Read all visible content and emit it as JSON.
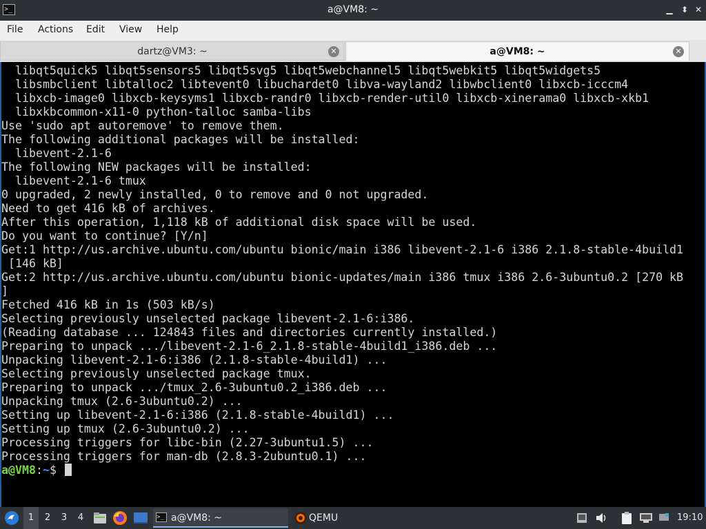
{
  "window": {
    "title": "a@VM8: ~",
    "app_icon": "terminal-icon",
    "buttons": {
      "minimize": "minimize-icon",
      "maximize": "maximize-icon",
      "close": "close-icon"
    }
  },
  "menu": [
    "File",
    "Actions",
    "Edit",
    "View",
    "Help"
  ],
  "tabs": [
    {
      "label": "dartz@VM3: ~",
      "active": false
    },
    {
      "label": "a@VM8: ~",
      "active": true
    }
  ],
  "terminal": {
    "lines": [
      "  libqt5quick5 libqt5sensors5 libqt5svg5 libqt5webchannel5 libqt5webkit5 libqt5widgets5",
      "  libsmbclient libtalloc2 libtevent0 libuchardet0 libva-wayland2 libwbclient0 libxcb-icccm4",
      "  libxcb-image0 libxcb-keysyms1 libxcb-randr0 libxcb-render-util0 libxcb-xinerama0 libxcb-xkb1",
      "  libxkbcommon-x11-0 python-talloc samba-libs",
      "Use 'sudo apt autoremove' to remove them.",
      "The following additional packages will be installed:",
      "  libevent-2.1-6",
      "The following NEW packages will be installed:",
      "  libevent-2.1-6 tmux",
      "0 upgraded, 2 newly installed, 0 to remove and 0 not upgraded.",
      "Need to get 416 kB of archives.",
      "After this operation, 1,118 kB of additional disk space will be used.",
      "Do you want to continue? [Y/n]",
      "Get:1 http://us.archive.ubuntu.com/ubuntu bionic/main i386 libevent-2.1-6 i386 2.1.8-stable-4build1",
      " [146 kB]",
      "Get:2 http://us.archive.ubuntu.com/ubuntu bionic-updates/main i386 tmux i386 2.6-3ubuntu0.2 [270 kB",
      "]",
      "Fetched 416 kB in 1s (503 kB/s)",
      "Selecting previously unselected package libevent-2.1-6:i386.",
      "(Reading database ... 124843 files and directories currently installed.)",
      "Preparing to unpack .../libevent-2.1-6_2.1.8-stable-4build1_i386.deb ...",
      "Unpacking libevent-2.1-6:i386 (2.1.8-stable-4build1) ...",
      "Selecting previously unselected package tmux.",
      "Preparing to unpack .../tmux_2.6-3ubuntu0.2_i386.deb ...",
      "Unpacking tmux (2.6-3ubuntu0.2) ...",
      "Setting up libevent-2.1-6:i386 (2.1.8-stable-4build1) ...",
      "Setting up tmux (2.6-3ubuntu0.2) ...",
      "Processing triggers for libc-bin (2.27-3ubuntu1.5) ...",
      "Processing triggers for man-db (2.8.3-2ubuntu0.1) ..."
    ],
    "prompt": {
      "user": "a@VM8",
      "sep": ":",
      "path": "~",
      "symbol": "$ "
    }
  },
  "taskbar": {
    "start_icon": "lubuntu-start-icon",
    "workspaces": [
      "1",
      "2",
      "3",
      "4"
    ],
    "active_workspace": "1",
    "quicklaunch": [
      "file-manager-icon",
      "firefox-icon",
      "desktop-icon"
    ],
    "tasks": [
      {
        "label": "a@VM8: ~",
        "icon": "terminal-icon",
        "active": true
      },
      {
        "label": "QEMU",
        "icon": "qemu-icon",
        "active": false
      }
    ],
    "tray": [
      "volume-icon",
      "clipboard-icon",
      "network-icon"
    ],
    "clock": "19:10"
  },
  "colors": {
    "titlebar_bg": "#2d3236",
    "terminal_bg": "#000000",
    "terminal_fg": "#d6d6d6",
    "prompt_user": "#7cd34a",
    "prompt_path": "#5b8be8",
    "accent": "#1f5fa8"
  }
}
